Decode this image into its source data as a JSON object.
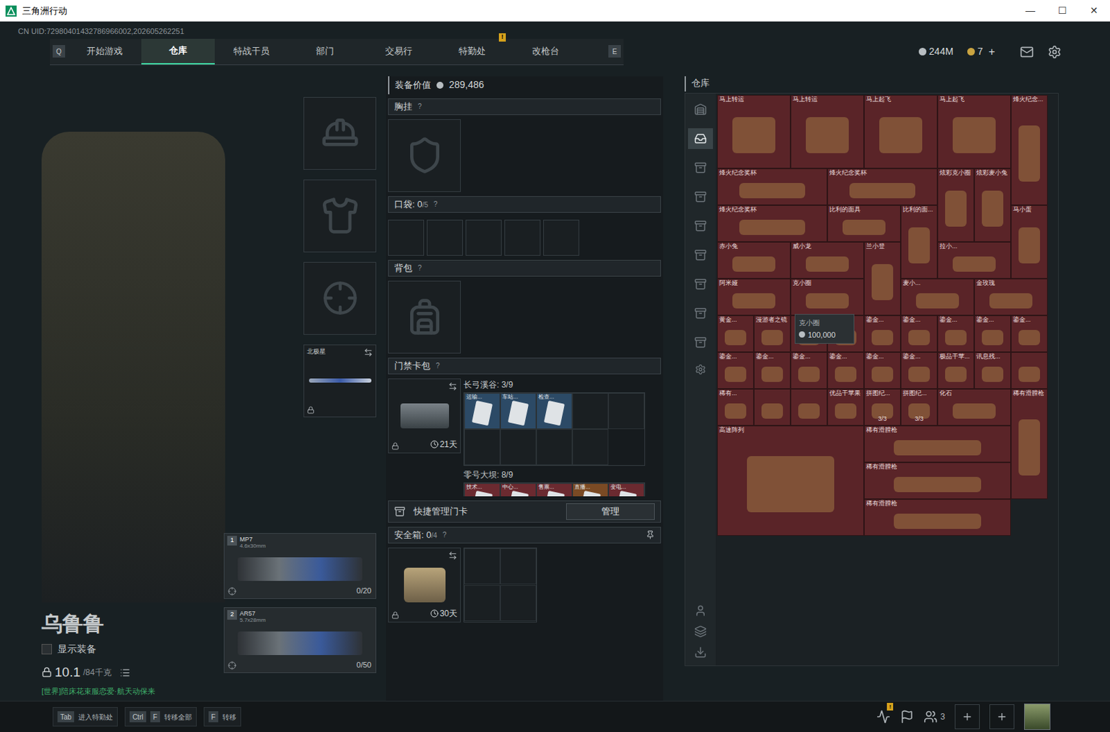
{
  "window": {
    "title": "三角洲行动",
    "controls": [
      "—",
      "☐",
      "✕"
    ]
  },
  "uid": "CN UID:72980401432786966002,202605262251",
  "nav": {
    "prev_key": "Q",
    "next_key": "E",
    "tabs": [
      {
        "label": "开始游戏",
        "selected": false,
        "alert": ""
      },
      {
        "label": "仓库",
        "selected": true,
        "alert": ""
      },
      {
        "label": "特战干员",
        "selected": false,
        "alert": ""
      },
      {
        "label": "部门",
        "selected": false,
        "alert": ""
      },
      {
        "label": "交易行",
        "selected": false,
        "alert": ""
      },
      {
        "label": "特勤处",
        "selected": false,
        "alert": "!"
      },
      {
        "label": "改枪台",
        "selected": false,
        "alert": ""
      }
    ]
  },
  "currency": {
    "coins": "244M",
    "tokens": "7",
    "add": "+"
  },
  "character": {
    "name": "乌鲁鲁",
    "show_gear": {
      "label": "显示装备",
      "checked": false
    },
    "weight": "10.1",
    "weight_max": "/84千克",
    "chat": "[世界]陪床花束服恋爱·航天动保来"
  },
  "melee": {
    "name": "北极星",
    "locked": true
  },
  "weapons": [
    {
      "slot": "1",
      "name": "MP7",
      "ammo_type": "4.6x30mm",
      "ammo": "0/20"
    },
    {
      "slot": "2",
      "name": "AR57",
      "ammo_type": "5.7x28mm",
      "ammo": "0/50"
    }
  ],
  "loadout": {
    "value_label": "装备价值",
    "value": "289,486",
    "chest": {
      "label": "胸挂",
      "help": "?"
    },
    "pockets": {
      "label": "口袋:",
      "count": "0",
      "capacity": "/5",
      "help": "?",
      "slots": 5
    },
    "backpack": {
      "label": "背包",
      "help": "?"
    },
    "keycards": {
      "label": "门禁卡包",
      "help": "?",
      "days": "21天",
      "locked": true,
      "maps": [
        {
          "name": "长弓溪谷: 3/9",
          "slots": 9,
          "cards": [
            {
              "label": "运输...",
              "color": "#2c4a66"
            },
            {
              "label": "车站...",
              "color": "#2c4a66"
            },
            {
              "label": "检查...",
              "color": "#2c4a66"
            }
          ]
        },
        {
          "name": "零号大坝: 8/9",
          "slots": 5,
          "cards": [
            {
              "label": "技术...",
              "color": "#6b2a30"
            },
            {
              "label": "中心...",
              "color": "#6b2a30"
            },
            {
              "label": "售票...",
              "color": "#6b2a30"
            },
            {
              "label": "直播...",
              "color": "#7a4a24"
            },
            {
              "label": "变电...",
              "color": "#6b2a30"
            }
          ]
        }
      ]
    },
    "quick": {
      "label": "快捷管理门卡",
      "button": "管理"
    },
    "safe": {
      "label": "安全箱:",
      "count": "0",
      "capacity": "/4",
      "help": "?",
      "days": "30天",
      "locked": true,
      "slots": 4
    }
  },
  "warehouse": {
    "title": "仓库",
    "sidebar": [
      {
        "selected": false
      },
      {
        "selected": true
      },
      {
        "selected": false
      },
      {
        "selected": false
      },
      {
        "selected": false
      },
      {
        "selected": false
      },
      {
        "selected": false
      },
      {
        "selected": false
      },
      {
        "selected": false
      }
    ],
    "items": [
      {
        "name": "马上转运",
        "kind": "s22",
        "count": ""
      },
      {
        "name": "马上转运",
        "kind": "s22",
        "count": ""
      },
      {
        "name": "马上起飞",
        "kind": "s22",
        "count": ""
      },
      {
        "name": "马上起飞",
        "kind": "s22",
        "count": ""
      },
      {
        "name": "烽火纪念...",
        "kind": "s13",
        "count": ""
      },
      {
        "name": "烽火纪念奖杯",
        "kind": "s31",
        "count": ""
      },
      {
        "name": "烽火纪念奖杯",
        "kind": "s31",
        "count": ""
      },
      {
        "name": "炫彩克小圈",
        "kind": "s12",
        "count": ""
      },
      {
        "name": "炫彩麦小兔",
        "kind": "s12",
        "count": ""
      },
      {
        "name": "烽火纪念奖杯",
        "kind": "s31",
        "count": ""
      },
      {
        "name": "比利的面具",
        "kind": "s21",
        "count": ""
      },
      {
        "name": "比利的面...",
        "kind": "s12",
        "count": ""
      },
      {
        "name": "马小蛋",
        "kind": "s12",
        "count": ""
      },
      {
        "name": "赤小兔",
        "kind": "s21",
        "count": ""
      },
      {
        "name": "威小龙",
        "kind": "s21",
        "count": ""
      },
      {
        "name": "兰小登",
        "kind": "s12",
        "count": ""
      },
      {
        "name": "拉小...",
        "kind": "s21",
        "count": ""
      },
      {
        "name": "阿米娅",
        "kind": "s21",
        "count": ""
      },
      {
        "name": "克小圈",
        "kind": "s21",
        "count": ""
      },
      {
        "name": "麦小...",
        "kind": "s21",
        "count": ""
      },
      {
        "name": "金玫瑰",
        "kind": "s21",
        "count": ""
      },
      {
        "name": "黄金...",
        "kind": "s11",
        "count": ""
      },
      {
        "name": "漫游者之镜",
        "kind": "s11",
        "count": ""
      },
      {
        "name": "",
        "kind": "s11",
        "count": ""
      },
      {
        "name": "",
        "kind": "s11",
        "count": ""
      },
      {
        "name": "鎏金...",
        "kind": "s11",
        "count": ""
      },
      {
        "name": "鎏金...",
        "kind": "s11",
        "count": ""
      },
      {
        "name": "鎏金...",
        "kind": "s11",
        "count": ""
      },
      {
        "name": "鎏金...",
        "kind": "s11",
        "count": ""
      },
      {
        "name": "鎏金...",
        "kind": "s11",
        "count": ""
      },
      {
        "name": "鎏金...",
        "kind": "s11",
        "count": ""
      },
      {
        "name": "鎏金...",
        "kind": "s11",
        "count": ""
      },
      {
        "name": "鎏金...",
        "kind": "s11",
        "count": ""
      },
      {
        "name": "鎏金...",
        "kind": "s11",
        "count": ""
      },
      {
        "name": "鎏金...",
        "kind": "s11",
        "count": ""
      },
      {
        "name": "鎏金...",
        "kind": "s11",
        "count": ""
      },
      {
        "name": "极品干苹...",
        "kind": "s11",
        "count": ""
      },
      {
        "name": "讯息残...",
        "kind": "s11",
        "count": ""
      },
      {
        "name": "",
        "kind": "s11",
        "count": ""
      },
      {
        "name": "稀有...",
        "kind": "s11",
        "count": ""
      },
      {
        "name": "",
        "kind": "s11",
        "count": ""
      },
      {
        "name": "",
        "kind": "s11",
        "count": ""
      },
      {
        "name": "优品干苹果",
        "kind": "s11",
        "count": ""
      },
      {
        "name": "拼图纪...",
        "kind": "s11",
        "count": "3/3"
      },
      {
        "name": "拼图纪...",
        "kind": "s11",
        "count": "3/3"
      },
      {
        "name": "化石",
        "kind": "s21",
        "count": ""
      },
      {
        "name": "稀有滑膛枪",
        "kind": "s13",
        "count": ""
      },
      {
        "name": "高速阵列",
        "kind": "s43",
        "count": ""
      },
      {
        "name": "稀有滑膛枪",
        "kind": "s41",
        "count": ""
      },
      {
        "name": "稀有滑膛枪",
        "kind": "s41",
        "count": ""
      },
      {
        "name": "稀有滑膛枪",
        "kind": "s41",
        "count": ""
      }
    ],
    "tooltip": {
      "name": "克小圈",
      "price": "100,000"
    }
  },
  "bottom": {
    "hints": [
      {
        "keys": [
          "Tab"
        ],
        "label": "进入特勤处"
      },
      {
        "keys": [
          "Ctrl",
          "F"
        ],
        "label": "转移全部"
      },
      {
        "keys": [
          "F"
        ],
        "label": "转移"
      }
    ],
    "alert": "!",
    "squad": "3"
  }
}
